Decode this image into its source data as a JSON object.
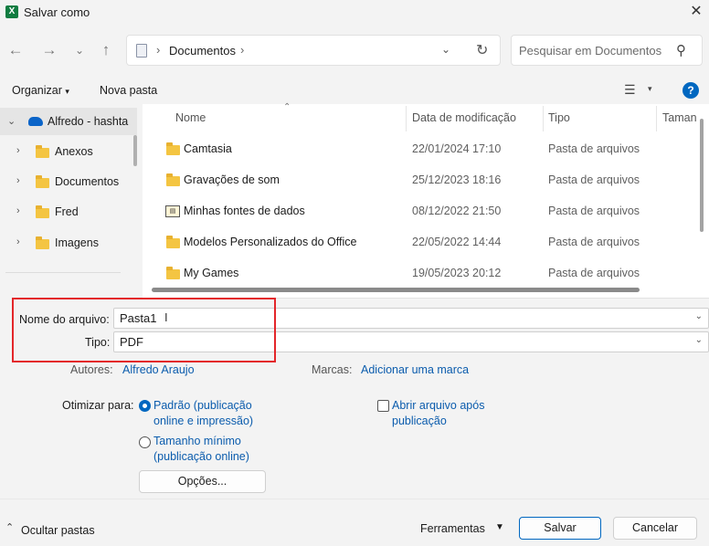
{
  "title": "Salvar como",
  "app_icon": "X",
  "address": {
    "path": "Documentos"
  },
  "search": {
    "placeholder": "Pesquisar em Documentos"
  },
  "toolbar": {
    "organize": "Organizar",
    "new_folder": "Nova pasta"
  },
  "navpane": {
    "items": [
      {
        "label": "Alfredo - hashta",
        "icon": "onedrive-cloud-icon",
        "expanded": true
      },
      {
        "label": "Anexos"
      },
      {
        "label": "Documentos"
      },
      {
        "label": "Fred"
      },
      {
        "label": "Imagens"
      }
    ]
  },
  "columns": {
    "name": "Nome",
    "date": "Data de modificação",
    "type": "Tipo",
    "size": "Taman"
  },
  "files": [
    {
      "name": "Camtasia",
      "date": "22/01/2024 17:10",
      "type": "Pasta de arquivos",
      "icon": "folder-icon"
    },
    {
      "name": "Gravações de som",
      "date": "25/12/2023 18:16",
      "type": "Pasta de arquivos",
      "icon": "folder-icon"
    },
    {
      "name": "Minhas fontes de dados",
      "date": "08/12/2022 21:50",
      "type": "Pasta de arquivos",
      "icon": "data-sources-folder-icon"
    },
    {
      "name": "Modelos Personalizados do Office",
      "date": "22/05/2022 14:44",
      "type": "Pasta de arquivos",
      "icon": "folder-icon"
    },
    {
      "name": "My Games",
      "date": "19/05/2023 20:12",
      "type": "Pasta de arquivos",
      "icon": "folder-icon"
    }
  ],
  "form": {
    "filename_label": "Nome do arquivo:",
    "filename_value": "Pasta1",
    "type_label": "Tipo:",
    "type_value": "PDF",
    "authors_label": "Autores:",
    "authors_value": "Alfredo Araujo",
    "tags_label": "Marcas:",
    "tags_value": "Adicionar uma marca",
    "optimize_label": "Otimizar para:",
    "opt_standard_1": "Padrão (publicação",
    "opt_standard_2": "online e impressão)",
    "opt_min_1": "Tamanho mínimo",
    "opt_min_2": "(publicação online)",
    "open_after_1": "Abrir arquivo após",
    "open_after_2": "publicação",
    "options_button": "Opções..."
  },
  "bottom": {
    "hide_folders": "Ocultar pastas",
    "tools": "Ferramentas",
    "save": "Salvar",
    "cancel": "Cancelar"
  },
  "colors": {
    "accent": "#0067c0",
    "highlight_box": "#e3262a",
    "folder": "#f4c542"
  }
}
